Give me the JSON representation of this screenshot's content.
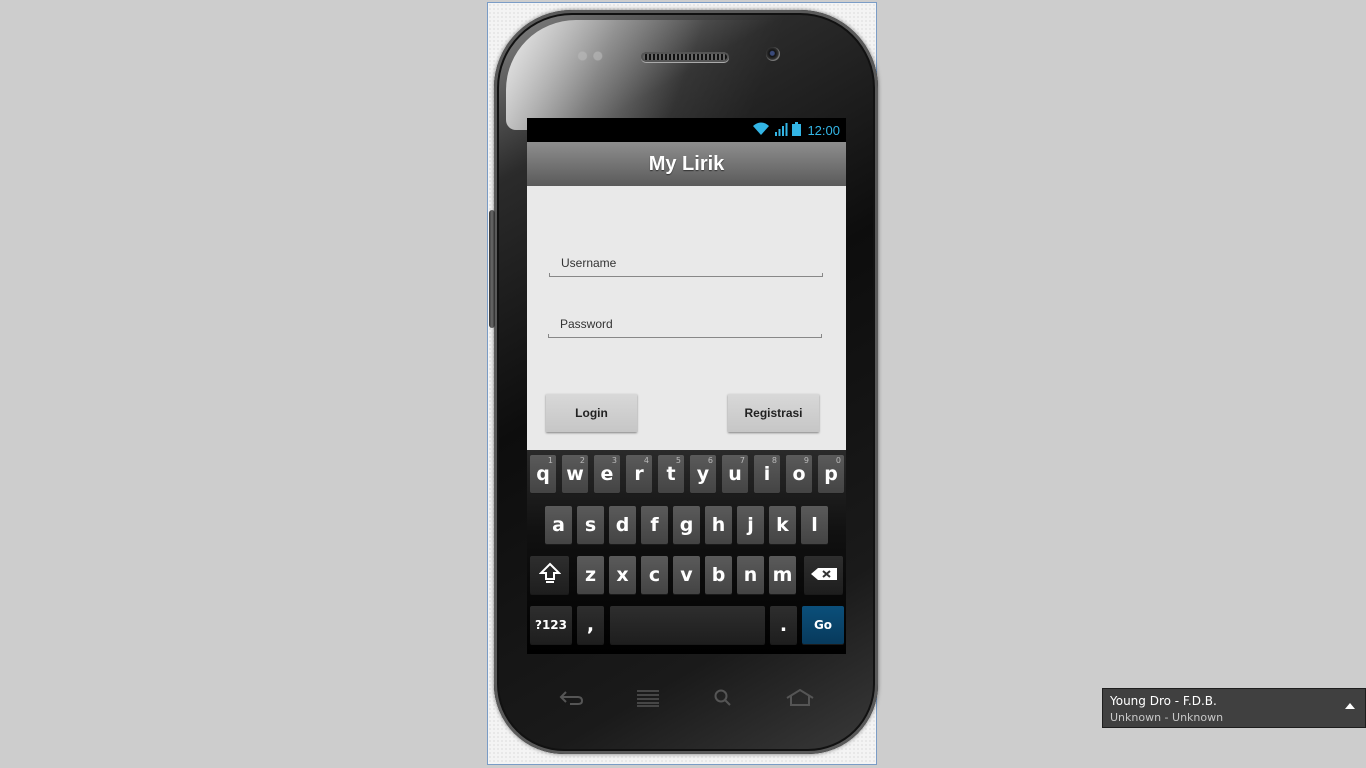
{
  "status_bar": {
    "time": "12:00",
    "icons": [
      "wifi-icon",
      "signal-icon",
      "battery-icon"
    ],
    "accent": "#33b5e5"
  },
  "app": {
    "title": "My Lirik"
  },
  "form": {
    "username_placeholder": "Username",
    "password_placeholder": "Password",
    "login_label": "Login",
    "register_label": "Registrasi"
  },
  "keyboard": {
    "row1": [
      {
        "k": "q",
        "h": "1"
      },
      {
        "k": "w",
        "h": "2"
      },
      {
        "k": "e",
        "h": "3"
      },
      {
        "k": "r",
        "h": "4"
      },
      {
        "k": "t",
        "h": "5"
      },
      {
        "k": "y",
        "h": "6"
      },
      {
        "k": "u",
        "h": "7"
      },
      {
        "k": "i",
        "h": "8"
      },
      {
        "k": "o",
        "h": "9"
      },
      {
        "k": "p",
        "h": "0"
      }
    ],
    "row2": [
      "a",
      "s",
      "d",
      "f",
      "g",
      "h",
      "j",
      "k",
      "l"
    ],
    "row3": [
      "z",
      "x",
      "c",
      "v",
      "b",
      "n",
      "m"
    ],
    "symbols_label": "?123",
    "comma_label": ",",
    "period_label": ".",
    "go_label": "Go",
    "go_color": "#0b4f7a"
  },
  "nav_bar": {
    "icons": [
      "back-icon",
      "recent-apps-icon",
      "search-icon",
      "home-icon"
    ]
  },
  "notification": {
    "title": "Young Dro - F.D.B.",
    "subtitle": "Unknown - Unknown"
  }
}
